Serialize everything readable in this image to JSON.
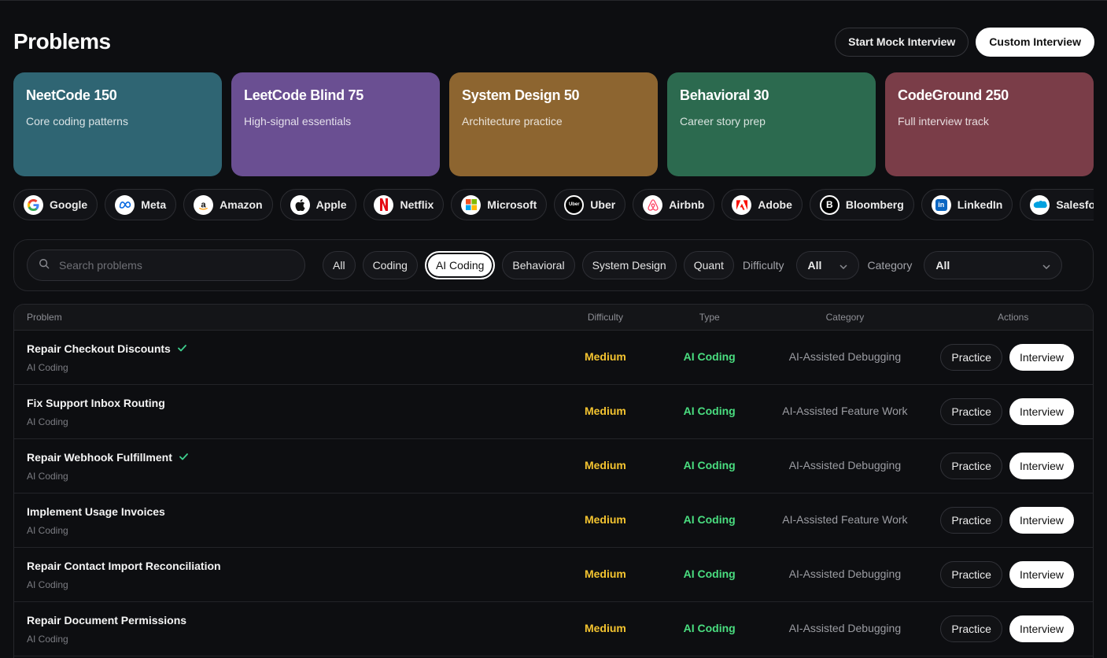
{
  "header": {
    "title": "Problems",
    "mock_label": "Start Mock Interview",
    "custom_label": "Custom Interview"
  },
  "tracks": [
    {
      "title": "NeetCode 150",
      "subtitle": "Core coding patterns",
      "color": "#2f6573"
    },
    {
      "title": "LeetCode Blind 75",
      "subtitle": "High-signal essentials",
      "color": "#6a4f92"
    },
    {
      "title": "System Design 50",
      "subtitle": "Architecture practice",
      "color": "#8d6530"
    },
    {
      "title": "Behavioral 30",
      "subtitle": "Career story prep",
      "color": "#2c6a4f"
    },
    {
      "title": "CodeGround 250",
      "subtitle": "Full interview track",
      "color": "#7a3d48"
    }
  ],
  "companies": [
    {
      "name": "Google",
      "icon": "google-logo"
    },
    {
      "name": "Meta",
      "icon": "meta-logo"
    },
    {
      "name": "Amazon",
      "icon": "amazon-logo"
    },
    {
      "name": "Apple",
      "icon": "apple-logo"
    },
    {
      "name": "Netflix",
      "icon": "netflix-logo"
    },
    {
      "name": "Microsoft",
      "icon": "microsoft-logo"
    },
    {
      "name": "Uber",
      "icon": "uber-logo",
      "logo_text": "Uber"
    },
    {
      "name": "Airbnb",
      "icon": "airbnb-logo"
    },
    {
      "name": "Adobe",
      "icon": "adobe-logo"
    },
    {
      "name": "Bloomberg",
      "icon": "bloomberg-logo",
      "logo_text": "B"
    },
    {
      "name": "LinkedIn",
      "icon": "linkedin-logo",
      "logo_text": "in"
    },
    {
      "name": "Salesforce",
      "icon": "salesforce-logo"
    }
  ],
  "filters": {
    "search_placeholder": "Search problems",
    "types": [
      "All",
      "Coding",
      "AI Coding",
      "Behavioral",
      "System Design",
      "Quant"
    ],
    "active_type": "AI Coding",
    "difficulty_label": "Difficulty",
    "difficulty_value": "All",
    "category_label": "Category",
    "category_value": "All"
  },
  "table": {
    "columns": {
      "problem": "Problem",
      "difficulty": "Difficulty",
      "type": "Type",
      "category": "Category",
      "actions": "Actions"
    },
    "practice_label": "Practice",
    "interview_label": "Interview",
    "rows": [
      {
        "title": "Repair Checkout Discounts",
        "subtitle": "AI Coding",
        "completed": true,
        "difficulty": "Medium",
        "type": "AI Coding",
        "category": "AI-Assisted Debugging"
      },
      {
        "title": "Fix Support Inbox Routing",
        "subtitle": "AI Coding",
        "completed": false,
        "difficulty": "Medium",
        "type": "AI Coding",
        "category": "AI-Assisted Feature Work"
      },
      {
        "title": "Repair Webhook Fulfillment",
        "subtitle": "AI Coding",
        "completed": true,
        "difficulty": "Medium",
        "type": "AI Coding",
        "category": "AI-Assisted Debugging"
      },
      {
        "title": "Implement Usage Invoices",
        "subtitle": "AI Coding",
        "completed": false,
        "difficulty": "Medium",
        "type": "AI Coding",
        "category": "AI-Assisted Feature Work"
      },
      {
        "title": "Repair Contact Import Reconciliation",
        "subtitle": "AI Coding",
        "completed": false,
        "difficulty": "Medium",
        "type": "AI Coding",
        "category": "AI-Assisted Debugging"
      },
      {
        "title": "Repair Document Permissions",
        "subtitle": "AI Coding",
        "completed": false,
        "difficulty": "Medium",
        "type": "AI Coding",
        "category": "AI-Assisted Debugging"
      }
    ]
  },
  "colors": {
    "background": "#0d0e11",
    "difficulty_medium": "#f4c430",
    "type_ai_coding": "#4ade80",
    "check": "#3ecf8e"
  }
}
